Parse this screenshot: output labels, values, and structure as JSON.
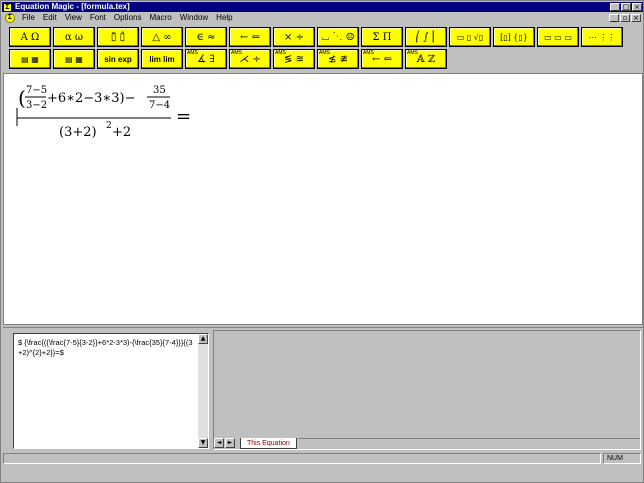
{
  "titlebar": {
    "title": "Equation Magic - [formula.tex]",
    "app_icon": "Σ",
    "buttons": [
      "_",
      "□",
      "×"
    ]
  },
  "menubar": {
    "items": [
      "File",
      "Edit",
      "View",
      "Font",
      "Options",
      "Macro",
      "Window",
      "Help"
    ],
    "mdi_buttons": [
      "_",
      "▫",
      "×"
    ]
  },
  "toolbar_row1": [
    {
      "name": "palette-greek-upper",
      "glyphs": "A Ω"
    },
    {
      "name": "palette-greek-lower",
      "glyphs": "α ω"
    },
    {
      "name": "palette-accents",
      "glyphs": "▯̃ ▯̂"
    },
    {
      "name": "palette-misc-symbols",
      "glyphs": "△ ∞"
    },
    {
      "name": "palette-relations",
      "glyphs": "∈ ≈"
    },
    {
      "name": "palette-arrows",
      "glyphs": "← ⇐"
    },
    {
      "name": "palette-operators",
      "glyphs": "× ÷"
    },
    {
      "name": "palette-spaces-dots",
      "glyphs": "⌴ ⋱ ☺"
    },
    {
      "name": "palette-big-operators",
      "glyphs": "Σ Π"
    },
    {
      "name": "palette-integrals-delims",
      "glyphs": "⎛ ∫ ⎜"
    },
    {
      "name": "palette-fractions-roots",
      "glyphs": "▭ ▯ √▯"
    },
    {
      "name": "palette-brackets",
      "glyphs": "[▯] {▯}"
    },
    {
      "name": "palette-boxes",
      "glyphs": "▭ ▭ ▭"
    },
    {
      "name": "palette-matrices",
      "glyphs": "⋯ ⋮⋮"
    }
  ],
  "toolbar_row2": [
    {
      "name": "palette-arrays",
      "glyphs": "▤ ▦"
    },
    {
      "name": "palette-stacks",
      "glyphs": "▤ ▦"
    },
    {
      "name": "palette-functions",
      "glyphs": "sin exp"
    },
    {
      "name": "palette-limits",
      "glyphs": "lim lim"
    },
    {
      "name": "palette-ams-misc",
      "glyphs": "∡ ∃",
      "label": "AMS"
    },
    {
      "name": "palette-ams-binary",
      "glyphs": "⋌ ÷",
      "label": "AMS"
    },
    {
      "name": "palette-ams-relations",
      "glyphs": "≶ ≊",
      "label": "AMS"
    },
    {
      "name": "palette-ams-negated",
      "glyphs": "≴ ≇",
      "label": "AMS"
    },
    {
      "name": "palette-ams-arrows",
      "glyphs": "← ⇐",
      "label": "AMS"
    },
    {
      "name": "palette-ams-fonts",
      "glyphs": "𝔸 ℤ",
      "label": "AMS"
    }
  ],
  "equation": {
    "inner_num": "7−5",
    "inner_den": "3−2",
    "middle": "+6∗2−3∗3)−",
    "frac2_num": "35",
    "frac2_den": "7−4",
    "denominator": "(3+2)",
    "denominator_exp": "2",
    "denominator_tail": "+2",
    "open_paren": "(",
    "equals": "="
  },
  "source": {
    "text": "$ {\\frac{({\\frac{7-5}{3-2}}+6*2-3*3)-{\\frac{35}{7-4}}}{(3+2)^{2}+2}}=$"
  },
  "preview": {
    "tab_label": "This Equation",
    "nav": [
      "◄",
      "►"
    ]
  },
  "statusbar": {
    "num": "NUM"
  }
}
